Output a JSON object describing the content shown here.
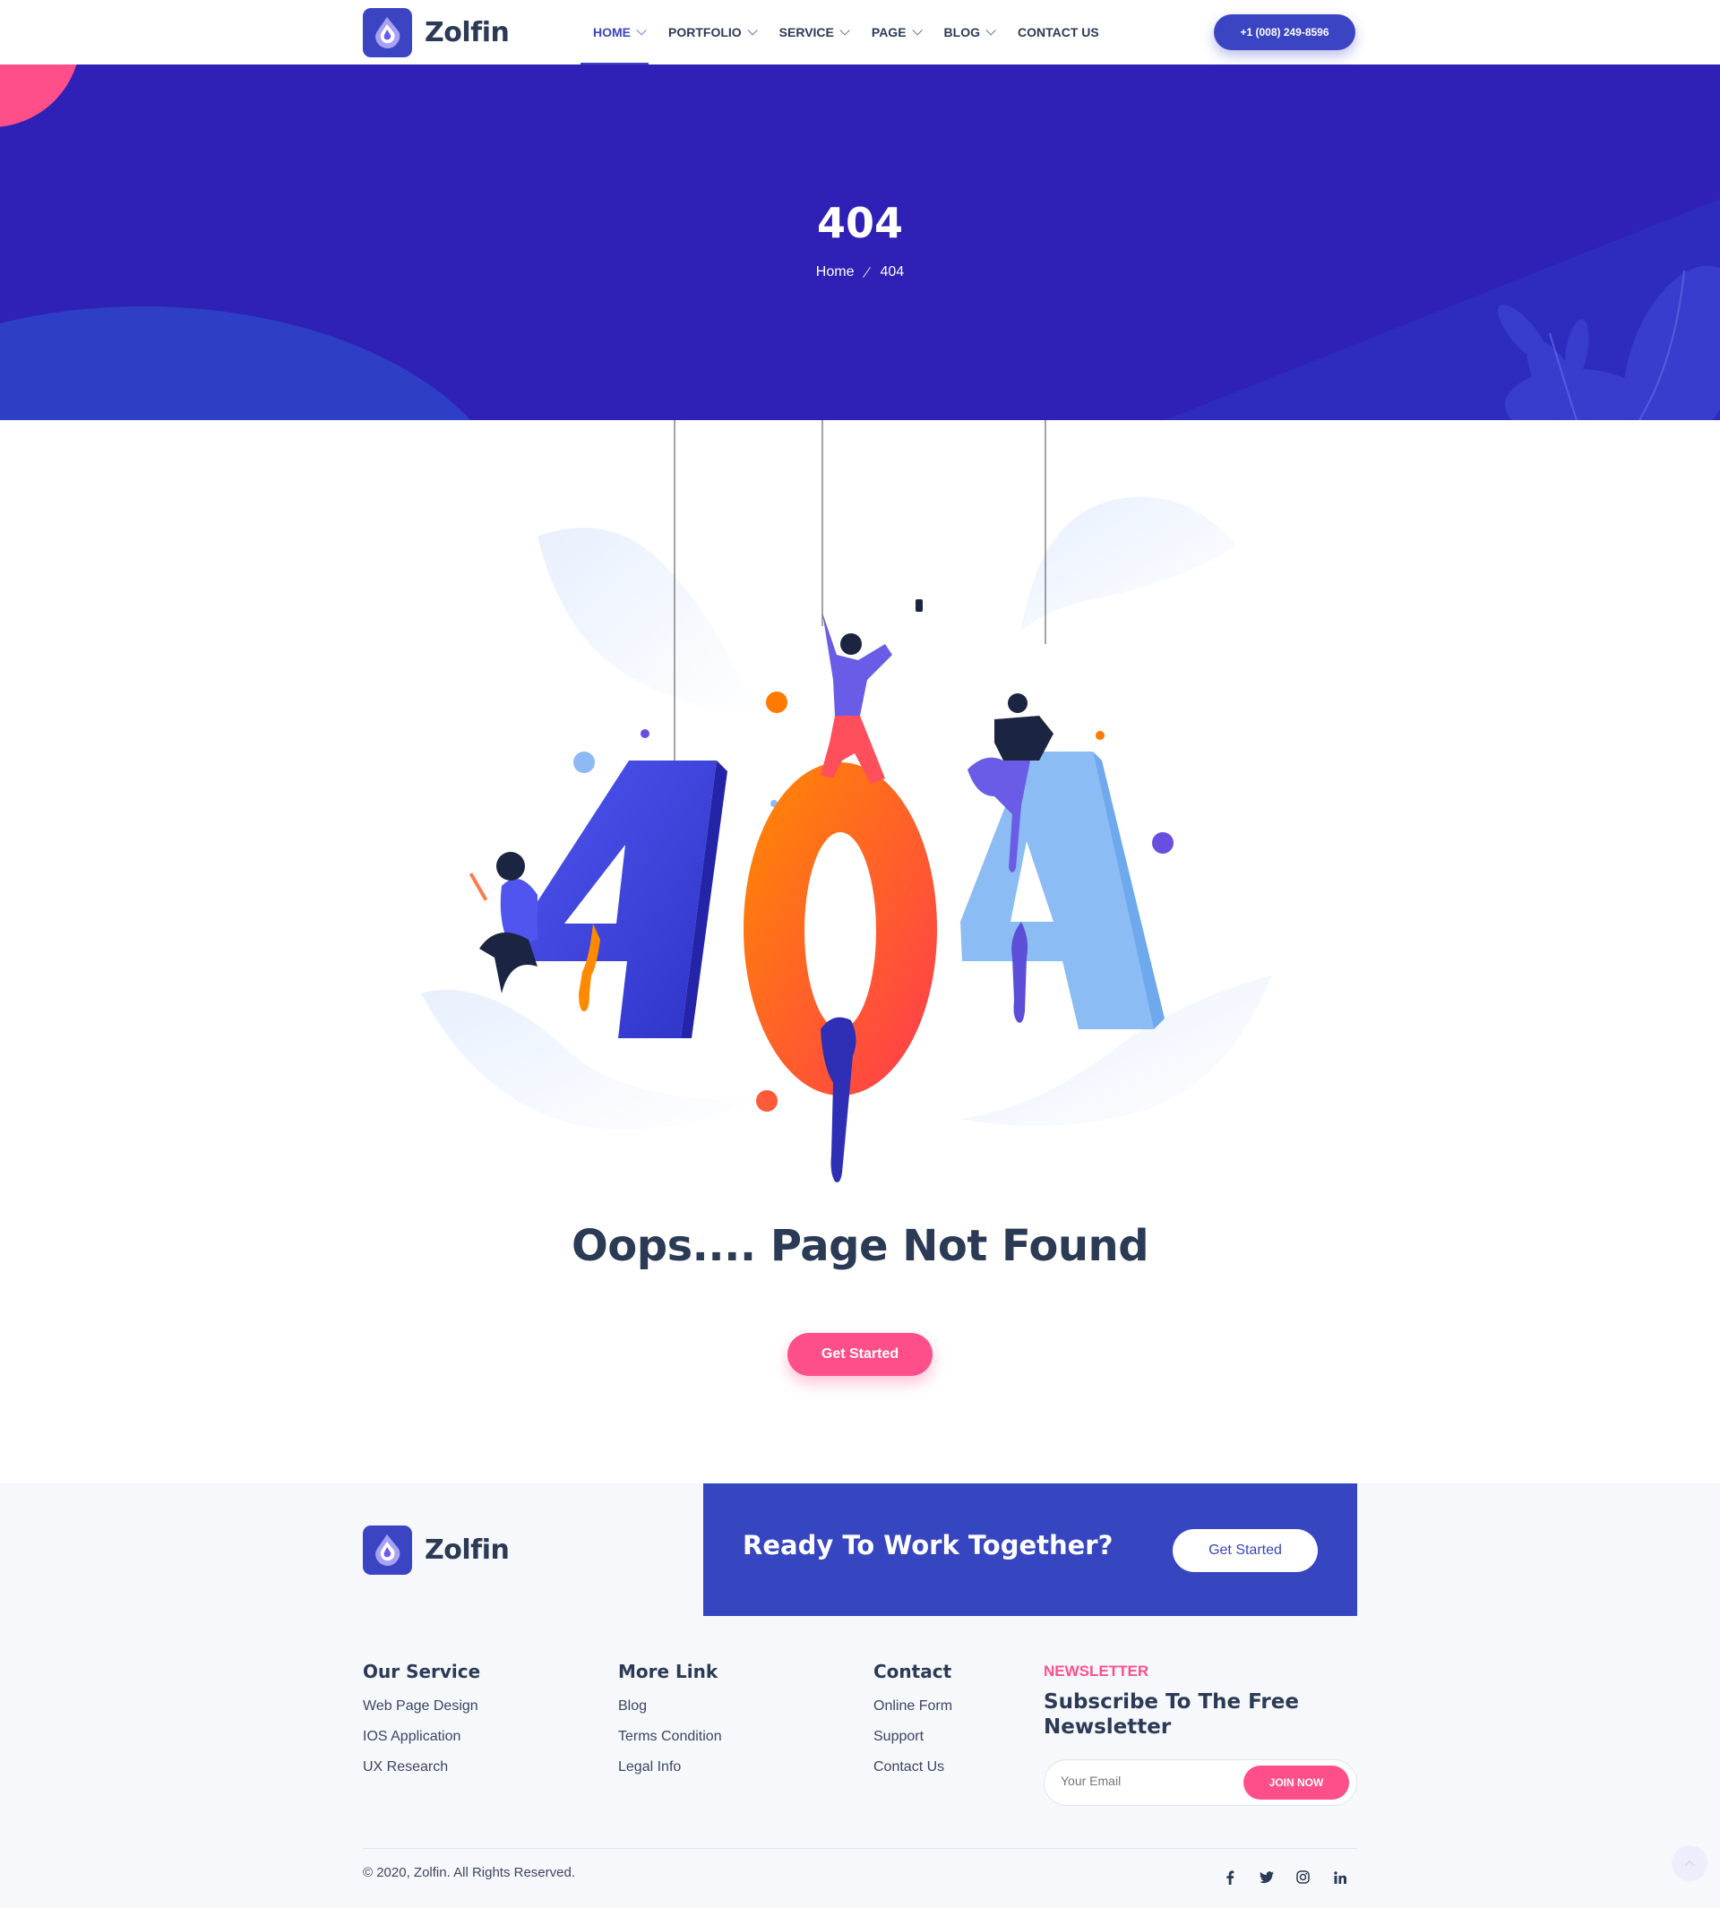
{
  "header": {
    "brand": "Zolfin",
    "nav": [
      {
        "label": "HOME",
        "dropdown": true,
        "active": true
      },
      {
        "label": "PORTFOLIO",
        "dropdown": true
      },
      {
        "label": "SERVICE",
        "dropdown": true
      },
      {
        "label": "PAGE",
        "dropdown": true
      },
      {
        "label": "BLOG",
        "dropdown": true
      },
      {
        "label": "CONTACT US",
        "dropdown": false
      }
    ],
    "phone": "+1 (008) 249-8596"
  },
  "hero": {
    "title": "404",
    "breadcrumb": [
      "Home",
      "404"
    ]
  },
  "main": {
    "heading": "Oops.... Page Not Found",
    "cta_label": "Get Started"
  },
  "footer": {
    "brand": "Zolfin",
    "cta": {
      "text": "Ready To Work Together?",
      "button": "Get Started"
    },
    "columns": [
      {
        "title": "Our Service",
        "links": [
          "Web Page Design",
          "IOS Application",
          "UX Research"
        ]
      },
      {
        "title": "More Link",
        "links": [
          "Blog",
          "Terms Condition",
          "Legal Info"
        ]
      },
      {
        "title": "Contact",
        "links": [
          "Online Form",
          "Support",
          "Contact Us"
        ]
      }
    ],
    "newsletter": {
      "label": "NEWSLETTER",
      "title": "Subscribe To The Free Newsletter",
      "placeholder": "Your Email",
      "button": "JOIN NOW"
    },
    "copyright": "© 2020, Zolfin. All Rights Reserved.",
    "socials": [
      "facebook-icon",
      "twitter-icon",
      "instagram-icon",
      "linkedin-icon"
    ]
  },
  "colors": {
    "brand": "#3b45c4",
    "hero_bg": "#2f20b6",
    "accent": "#ff4f8b",
    "text": "#2b3a55"
  }
}
